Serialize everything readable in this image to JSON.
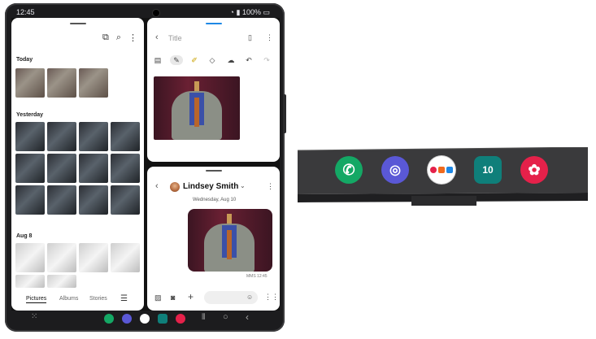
{
  "status": {
    "time": "12:45",
    "battery": "100%"
  },
  "gallery": {
    "sections": [
      "Today",
      "Yesterday",
      "Aug 8"
    ],
    "tabs": [
      "Pictures",
      "Albums",
      "Stories"
    ]
  },
  "notes": {
    "title": "Title"
  },
  "message": {
    "contact_name": "Lindsey Smith",
    "date": "Wednesday, Aug 10",
    "meta": "MMS 12:45"
  },
  "taskbar_apps": [
    "phone",
    "internet",
    "app-pair",
    "calendar",
    "gallery"
  ],
  "closeup": {
    "calendar_day": "10"
  },
  "colors": {
    "phone_green": "#14a865",
    "internet_purple": "#5a58d6",
    "calendar_teal": "#0f7f7a",
    "gallery_red": "#e5214a",
    "accent_blue": "#1e88e5"
  }
}
